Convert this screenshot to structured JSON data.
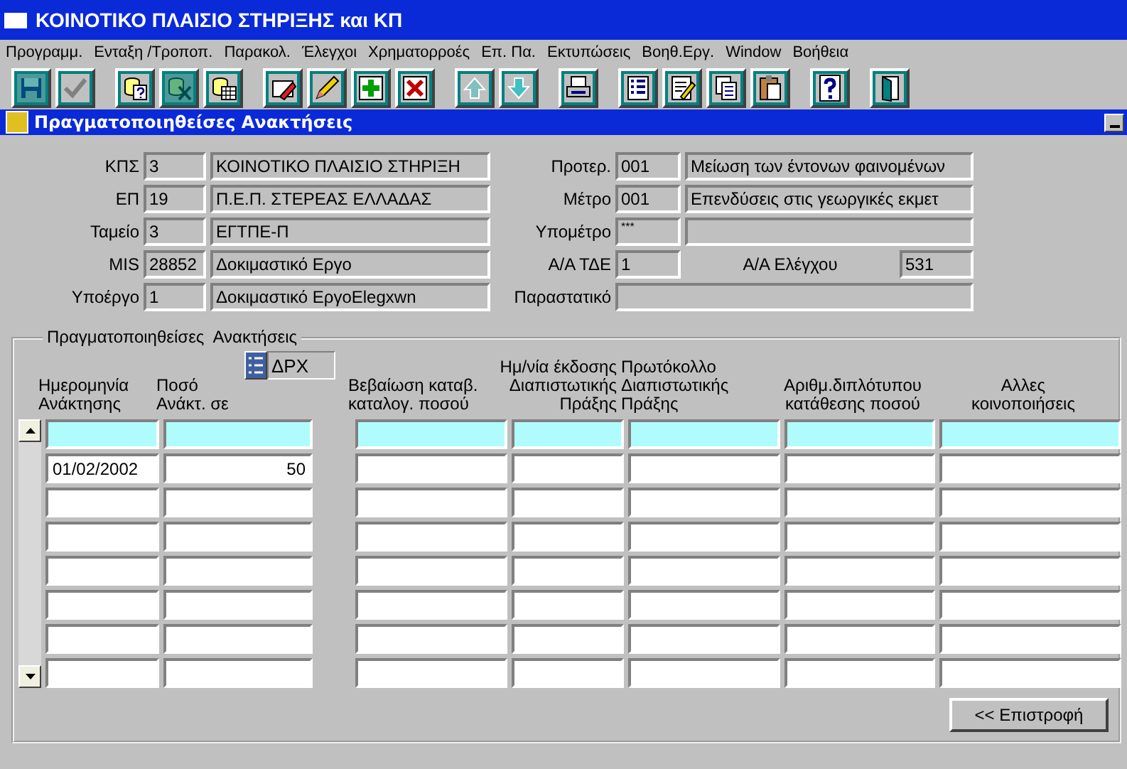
{
  "window": {
    "title": "ΚΟΙΝΟΤΙΚΟ ΠΛΑΙΣΙΟ ΣΤΗΡΙΞΗΣ και ΚΠ"
  },
  "menu": [
    "Προγραμμ.",
    "Ενταξη /Τροποπ.",
    "Παρακολ.",
    "Έλεγχοι",
    "Χρηματορροές",
    "Επ. Πα.",
    "Εκτυπώσεις",
    "Βοηθ.Εργ.",
    "Window",
    "Βοήθεια"
  ],
  "toolbar": [
    [
      {
        "kind": "save",
        "disabled": true
      },
      {
        "kind": "check",
        "disabled": false
      }
    ],
    [
      {
        "kind": "query",
        "disabled": false
      },
      {
        "kind": "clear",
        "disabled": true
      },
      {
        "kind": "grid",
        "disabled": false
      }
    ],
    [
      {
        "kind": "erase",
        "disabled": false
      },
      {
        "kind": "pencil",
        "disabled": false
      },
      {
        "kind": "add",
        "disabled": false
      },
      {
        "kind": "delete",
        "disabled": false
      }
    ],
    [
      {
        "kind": "up",
        "disabled": false
      },
      {
        "kind": "down",
        "disabled": false
      }
    ],
    [
      {
        "kind": "print",
        "disabled": false
      }
    ],
    [
      {
        "kind": "list",
        "disabled": false
      },
      {
        "kind": "edit",
        "disabled": false
      },
      {
        "kind": "copy",
        "disabled": false
      },
      {
        "kind": "paste",
        "disabled": false
      }
    ],
    [
      {
        "kind": "help",
        "disabled": false
      }
    ],
    [
      {
        "kind": "exit",
        "disabled": false
      }
    ]
  ],
  "form": {
    "title": "Πραγματοποιηθείσες Ανακτήσεις",
    "left_fields": [
      {
        "label": "ΚΠΣ",
        "code": "3",
        "name": "ΚΟΙΝΟΤΙΚΟ ΠΛΑΙΣΙΟ ΣΤΗΡΙΞΗ"
      },
      {
        "label": "ΕΠ",
        "code": "19",
        "name": "Π.Ε.Π. ΣΤΕΡΕΑΣ ΕΛΛΑΔΑΣ"
      },
      {
        "label": "Ταμείο",
        "code": "3",
        "name": "ΕΓΤΠΕ-Π"
      },
      {
        "label": "MIS",
        "code": "28852",
        "name": "Δοκιμαστικό Εργο"
      },
      {
        "label": "Υποέργο",
        "code": "1",
        "name": "Δοκιμαστικό ΕργοElegxwn"
      }
    ],
    "right_fields": [
      {
        "kind": "code_name",
        "label": "Προτερ.",
        "code": "001",
        "name": "Μείωση των έντονων φαινομένων"
      },
      {
        "kind": "code_name",
        "label": "Μέτρο",
        "code": "001",
        "name": "Επενδύσεις στις γεωργικές εκμετ"
      },
      {
        "kind": "code_name",
        "label": "Υπομέτρο",
        "code": "***"
      },
      {
        "kind": "code_pair",
        "label": "Α/Α ΤΔΕ",
        "code": "1",
        "label_2": "Α/Α Ελέγχου",
        "value_2": "531"
      },
      {
        "kind": "wide",
        "label": "Παραστατικό"
      }
    ],
    "group_title": "Πραγματοποιηθείσες  Ανακτήσεις",
    "currency": {
      "value": "ΔΡΧ"
    },
    "columns": [
      "Ημερομηνία\nΑνάκτησης",
      "Ποσό\nΑνάκτ. σε",
      "Βεβαίωση καταβ.\nκαταλογ. ποσού",
      "Ημ/νία έκδοσης\nΔιαπιστωτικής\nΠράξης",
      "Πρωτόκολλο\nΔιαπιστωτικής\nΠράξης",
      "Αριθμ.διπλότυπου\nκατάθεσης ποσού",
      "Αλλες\nκοινοποιήσεις"
    ],
    "rows": [
      {
        "current": true
      },
      {
        "current": false,
        "date": "01/02/2002",
        "amount": "50"
      },
      {
        "current": false
      },
      {
        "current": false
      },
      {
        "current": false
      },
      {
        "current": false
      },
      {
        "current": false
      },
      {
        "current": false
      }
    ],
    "back_button": "<< Επιστροφή"
  }
}
